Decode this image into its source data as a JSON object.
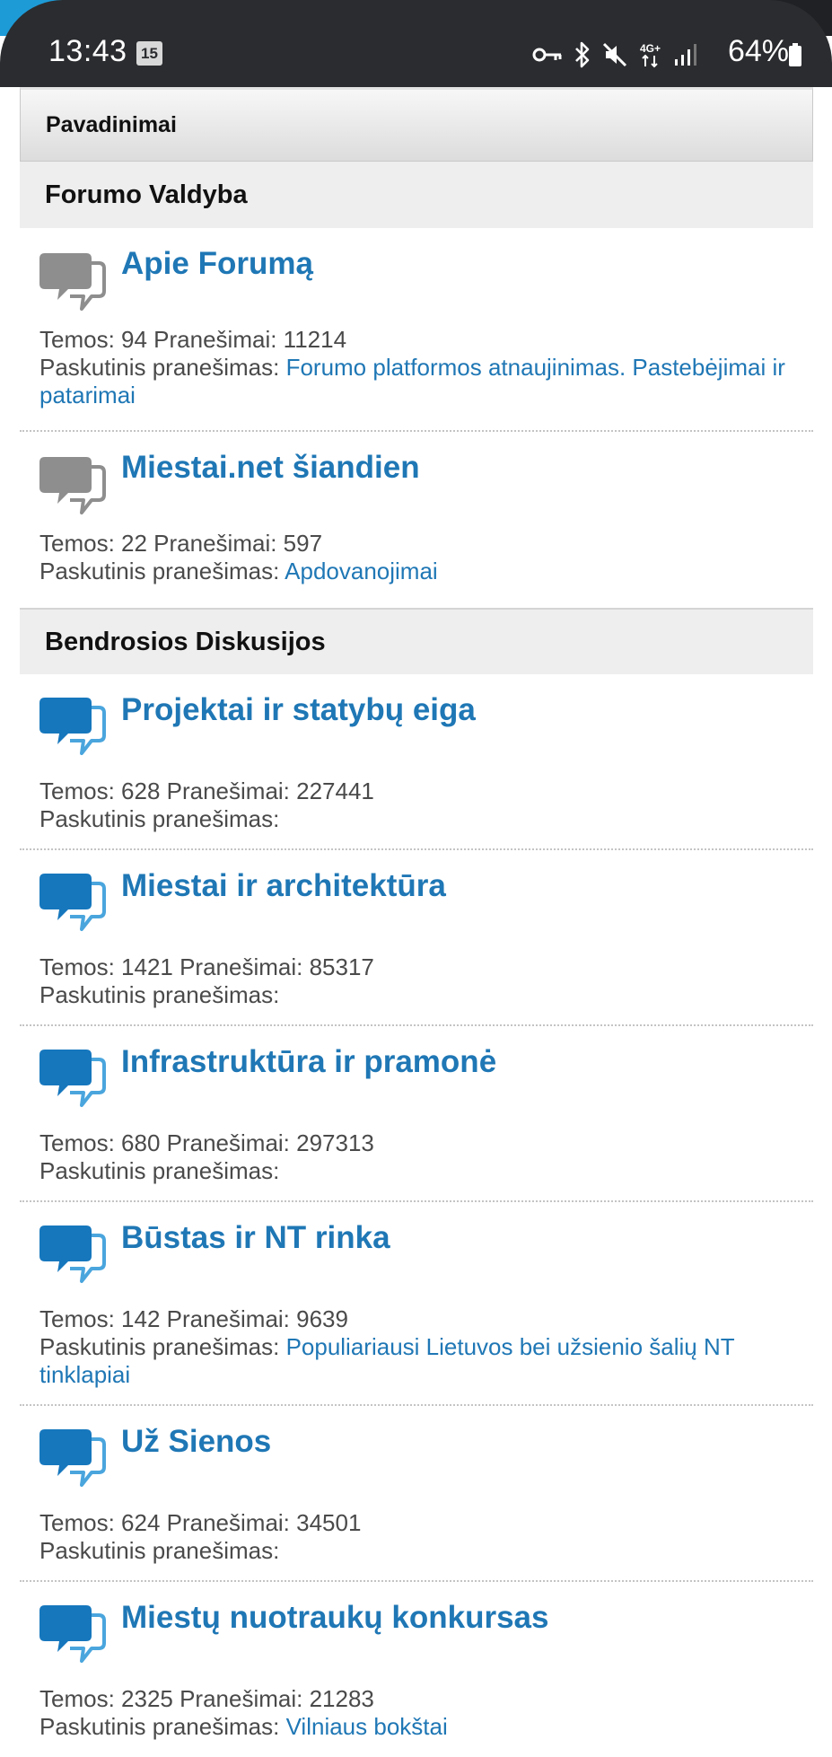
{
  "status_bar": {
    "time": "13:43",
    "notification_badge": "15",
    "battery": "64%",
    "icons": [
      "vpn-key-icon",
      "bluetooth-icon",
      "mute-icon",
      "4g-plus-icon",
      "signal-icon",
      "battery-icon"
    ]
  },
  "table_header": {
    "label": "Pavadinimai"
  },
  "stats_labels": {
    "topics": "Temos:",
    "posts": "Pranešimai:",
    "last_post": "Paskutinis pranešimas:"
  },
  "colors": {
    "link": "#1f77b5",
    "icon_gray": "#8e8e8e",
    "icon_blue": "#1677bd",
    "icon_light_blue": "#4aa5dd"
  },
  "categories": [
    {
      "title": "Forumo Valdyba",
      "icon": "gray-speech-bubbles-icon",
      "forums": [
        {
          "title": "Apie Forumą",
          "topics": "94",
          "posts": "11214",
          "last_post": "Forumo platformos atnaujinimas. Pastebėjimai ir patarimai"
        },
        {
          "title": "Miestai.net šiandien",
          "topics": "22",
          "posts": "597",
          "last_post": "Apdovanojimai"
        }
      ]
    },
    {
      "title": "Bendrosios Diskusijos",
      "icon": "blue-speech-bubbles-icon",
      "forums": [
        {
          "title": "Projektai ir statybų eiga",
          "topics": "628",
          "posts": "227441",
          "last_post": ""
        },
        {
          "title": "Miestai ir architektūra",
          "topics": "1421",
          "posts": "85317",
          "last_post": ""
        },
        {
          "title": "Infrastruktūra ir pramonė",
          "topics": "680",
          "posts": "297313",
          "last_post": ""
        },
        {
          "title": "Būstas ir NT rinka",
          "topics": "142",
          "posts": "9639",
          "last_post": "Populiariausi Lietuvos bei užsienio šalių NT tinklapiai"
        },
        {
          "title": "Už Sienos",
          "topics": "624",
          "posts": "34501",
          "last_post": ""
        },
        {
          "title": "Miestų nuotraukų konkursas",
          "topics": "2325",
          "posts": "21283",
          "last_post": "Vilniaus bokštai"
        }
      ]
    }
  ]
}
